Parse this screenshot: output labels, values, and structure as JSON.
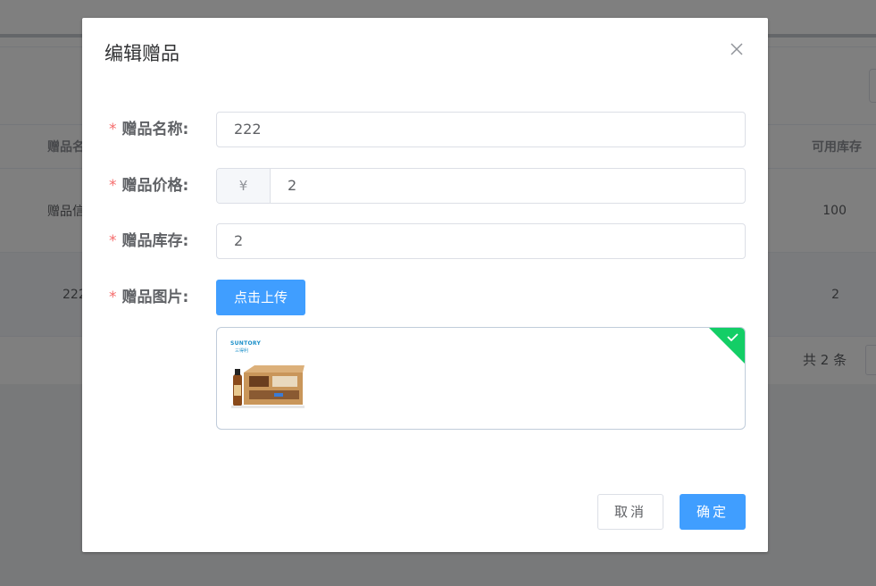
{
  "background": {
    "table": {
      "headers": {
        "name": "赠品名",
        "stock": "可用库存"
      },
      "rows": [
        {
          "name": "赠品信",
          "stock": "100"
        },
        {
          "name": "222",
          "stock": "2"
        }
      ]
    },
    "pagination": {
      "total": "共 2 条"
    }
  },
  "dialog": {
    "title": "编辑赠品",
    "required_mark": "*",
    "fields": {
      "name": {
        "label": "赠品名称:",
        "value": "222"
      },
      "price": {
        "label": "赠品价格:",
        "prefix": "¥",
        "value": "2"
      },
      "stock": {
        "label": "赠品库存:",
        "value": "2"
      },
      "image": {
        "label": "赠品图片:",
        "upload_button": "点击上传"
      }
    },
    "uploaded_file": {
      "brand": "SUNTORY",
      "brand_sub": "三得利",
      "status": "success"
    },
    "footer": {
      "cancel": "取消",
      "confirm": "确定"
    }
  },
  "colors": {
    "primary": "#409eff",
    "required": "#f56c6c",
    "success": "#13ce66",
    "overlay": "rgba(0,0,0,0.5)"
  },
  "icons": {
    "close": "close-icon",
    "success": "check-icon"
  }
}
